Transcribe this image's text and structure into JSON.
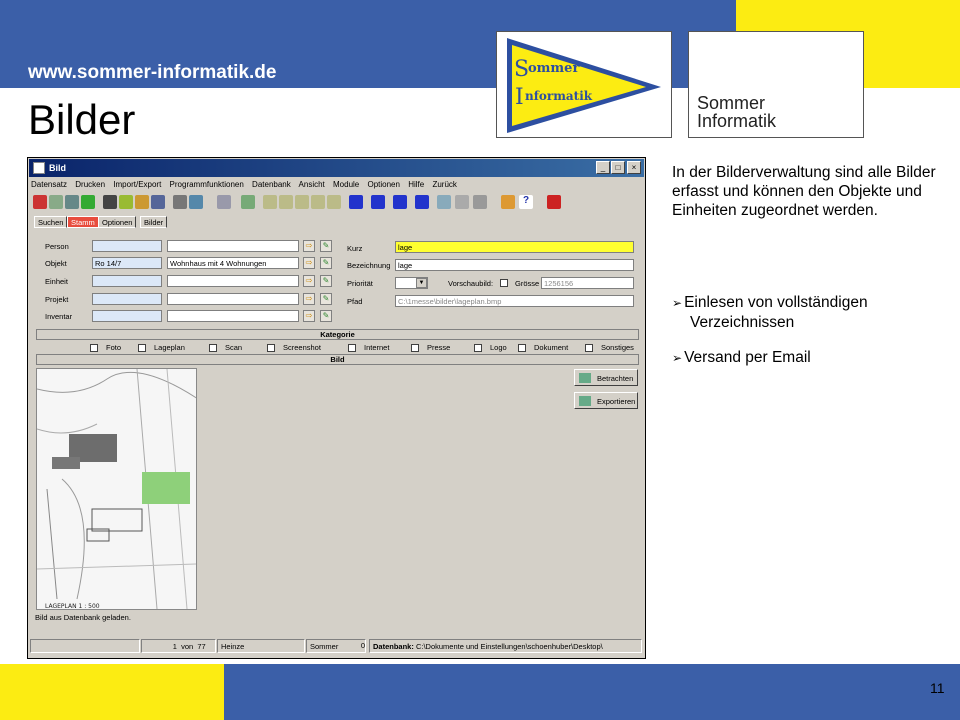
{
  "slide": {
    "url": "www.sommer-informatik.de",
    "title": "Bilder",
    "page_number": "11",
    "logo1_line1": "ommer",
    "logo1_line2": "nformatik",
    "logo1_s": "S",
    "logo1_i": "I",
    "logo2_line1": "Sommer",
    "logo2_line2": "Informatik",
    "description": "In der Bilderverwaltung sind alle Bilder erfasst und können den Objekte und Einheiten zugeordnet werden.",
    "bullets": [
      "Einlesen von vollständigen Verzeichnissen",
      "Versand per Email"
    ],
    "bullet_1a": "Einlesen von vollständigen",
    "bullet_1b": "Verzeichnissen",
    "bullet_2": "Versand per Email",
    "colors": {
      "blue": "#3b5fa8",
      "yellow": "#fcec12"
    }
  },
  "app": {
    "window_title": "Bild",
    "menu": [
      "Datensatz",
      "Drucken",
      "Import/Export",
      "Programmfunktionen",
      "Datenbank",
      "Ansicht",
      "Module",
      "Optionen",
      "Hilfe",
      "Zurück"
    ],
    "tabs": [
      "Suchen",
      "Stamm",
      "Optionen",
      "Bilder"
    ],
    "active_tab": "Stamm",
    "left_fields": {
      "person_label": "Person",
      "person_code": "",
      "person_name": "",
      "objekt_label": "Objekt",
      "objekt_code": "Ro 14/7",
      "objekt_name": "Wohnhaus mit 4 Wohnungen",
      "einheit_label": "Einheit",
      "einheit_code": "",
      "einheit_name": "",
      "projekt_label": "Projekt",
      "projekt_code": "",
      "projekt_name": "",
      "inventar_label": "Inventar",
      "inventar_code": "",
      "inventar_name": ""
    },
    "right_fields": {
      "kurz_label": "Kurz",
      "kurz_value": "lage",
      "bezeichnung_label": "Bezeichnung",
      "bezeichnung_value": "lage",
      "prioritaet_label": "Priorität",
      "prioritaet_value": "",
      "vorschaubild_label": "Vorschaubild:",
      "groesse_label": "Grösse",
      "groesse_value": "1256156",
      "pfad_label": "Pfad",
      "pfad_value": "C:\\1messe\\bilder\\lageplan.bmp"
    },
    "kategorie_header": "Kategorie",
    "categories": [
      "Foto",
      "Lageplan",
      "Scan",
      "Screenshot",
      "Internet",
      "Presse",
      "Logo",
      "Dokument",
      "Sonstiges"
    ],
    "bild_header": "Bild",
    "buttons": {
      "betrachten": "Betrachten",
      "exportieren": "Exportieren"
    },
    "image_caption": "LAGEPLAN  1 : 500",
    "status_message": "Bild aus Datenbank geladen.",
    "status": {
      "record_current": "1",
      "record_von": "von",
      "record_total": "77",
      "user": "Heinze",
      "user2": "Sommer",
      "count": "0",
      "db_label": "Datenbank:",
      "db_path": "C:\\Dokumente und Einstellungen\\schoenhuber\\Desktop\\"
    }
  }
}
